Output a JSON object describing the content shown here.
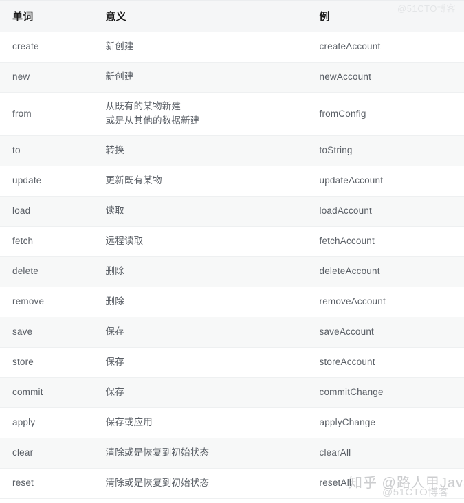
{
  "table": {
    "columns": [
      {
        "label": "单词"
      },
      {
        "label": "意义"
      },
      {
        "label": "例"
      }
    ],
    "rows": [
      {
        "word": "create",
        "meaning": "新创建",
        "example": "createAccount"
      },
      {
        "word": "new",
        "meaning": "新创建",
        "example": "newAccount"
      },
      {
        "word": "from",
        "meaning": "从既有的某物新建\n或是从其他的数据新建",
        "example": "fromConfig"
      },
      {
        "word": "to",
        "meaning": "转换",
        "example": "toString"
      },
      {
        "word": "update",
        "meaning": "更新既有某物",
        "example": "updateAccount"
      },
      {
        "word": "load",
        "meaning": "读取",
        "example": "loadAccount"
      },
      {
        "word": "fetch",
        "meaning": "远程读取",
        "example": "fetchAccount"
      },
      {
        "word": "delete",
        "meaning": "删除",
        "example": "deleteAccount"
      },
      {
        "word": "remove",
        "meaning": "删除",
        "example": "removeAccount"
      },
      {
        "word": "save",
        "meaning": "保存",
        "example": "saveAccount"
      },
      {
        "word": "store",
        "meaning": "保存",
        "example": "storeAccount"
      },
      {
        "word": "commit",
        "meaning": "保存",
        "example": "commitChange"
      },
      {
        "word": "apply",
        "meaning": "保存或应用",
        "example": "applyChange"
      },
      {
        "word": "clear",
        "meaning": "清除或是恢复到初始状态",
        "example": "clearAll"
      },
      {
        "word": "reset",
        "meaning": "清除或是恢复到初始状态",
        "example": "resetAll"
      }
    ]
  },
  "watermarks": {
    "zhihu": "知乎 @路人甲Java",
    "blog": "@51CTO博客",
    "topright": "@51CTO博客"
  },
  "colors": {
    "header_bg": "#f5f6f7",
    "row_alt_bg": "#f7f8f8",
    "row_bg": "#ffffff",
    "border": "#eef0f1",
    "header_text": "#1a1a1a",
    "body_text": "#5a5f66"
  }
}
